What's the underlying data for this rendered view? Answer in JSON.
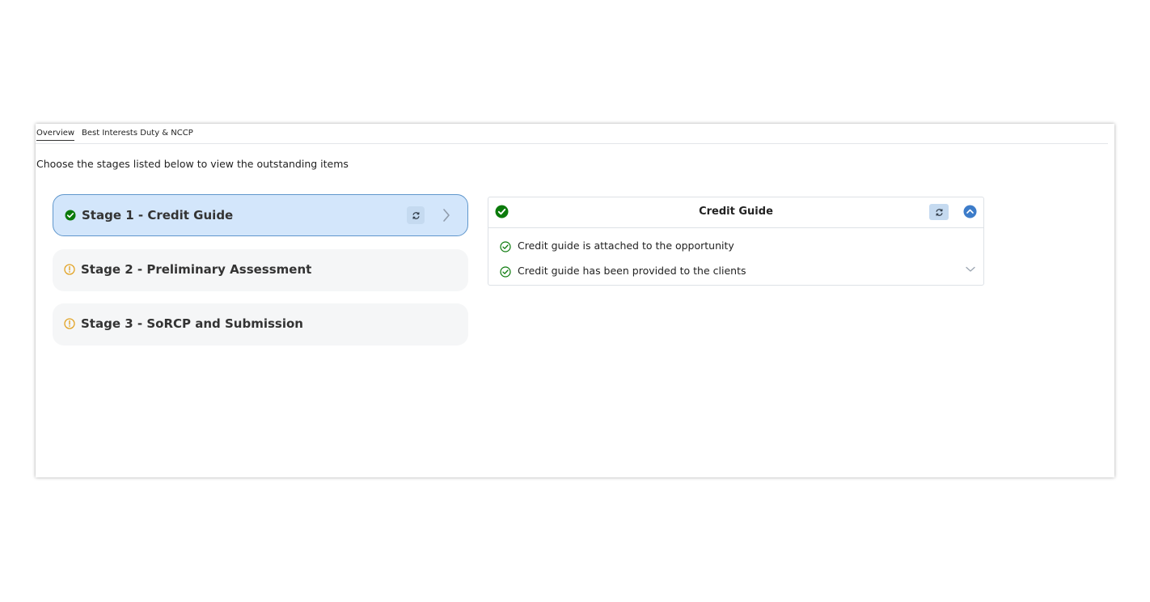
{
  "tabs": [
    {
      "label": "Overview",
      "active": true
    },
    {
      "label": "Best Interests Duty & NCCP",
      "active": false
    }
  ],
  "instruction": "Choose the stages listed below to view the outstanding items",
  "stages": [
    {
      "label": "Stage 1 - Credit Guide",
      "status": "complete",
      "selected": true
    },
    {
      "label": "Stage 2 - Preliminary Assessment",
      "status": "warning",
      "selected": false
    },
    {
      "label": "Stage 3 - SoRCP and Submission",
      "status": "warning",
      "selected": false
    }
  ],
  "detail": {
    "title": "Credit Guide",
    "status": "complete",
    "items": [
      {
        "text": "Credit guide is attached to the opportunity",
        "status": "complete"
      },
      {
        "text": "Credit guide has been provided to the clients",
        "status": "complete"
      }
    ]
  },
  "icons": {
    "complete": "check-circle-icon",
    "warning": "warning-circle-icon",
    "refresh": "refresh-icon",
    "chevron_right": "chevron-right-icon",
    "collapse": "chevron-up-circle-icon",
    "expand": "chevron-down-icon"
  },
  "colors": {
    "success": "#0b7a0b",
    "warning": "#e2a324",
    "selected_bg": "#d3e6fb",
    "selected_border": "#5f96cc",
    "accent": "#3d7cc9"
  }
}
